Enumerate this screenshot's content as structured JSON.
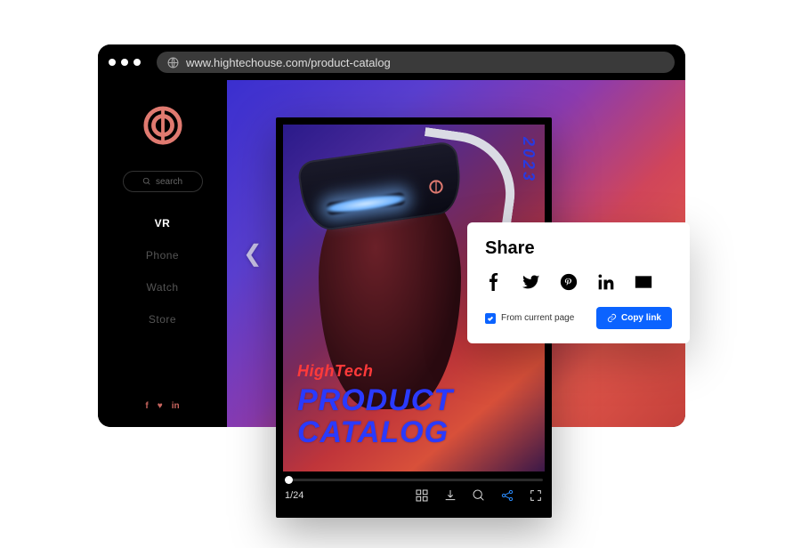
{
  "browser": {
    "url": "www.hightechouse.com/product-catalog"
  },
  "sidebar": {
    "search_placeholder": "search",
    "items": [
      "VR",
      "Phone",
      "Watch",
      "Store"
    ],
    "active_index": 0
  },
  "catalog": {
    "year": "2023",
    "brand": "HighTech",
    "title_line1": "PRODUCT",
    "title_line2": "CATALOG",
    "page_indicator": "1/24"
  },
  "share": {
    "heading": "Share",
    "checkbox_label": "From current page",
    "checkbox_checked": true,
    "copy_label": "Copy link"
  },
  "colors": {
    "accent_blue": "#0b63ff",
    "brand_red": "#ff3a3a",
    "title_blue": "#2a3aff"
  }
}
